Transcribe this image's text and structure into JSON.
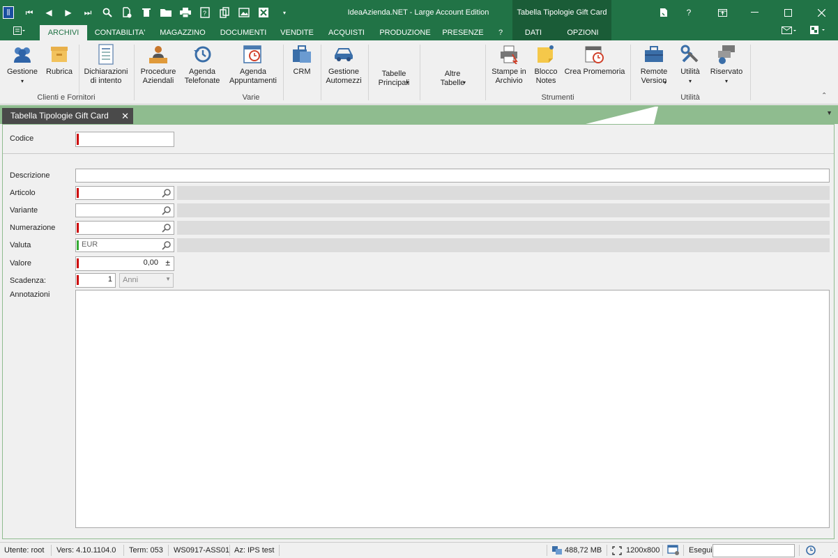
{
  "app": {
    "title": "IdeaAzienda.NET - Large Account Edition",
    "context_tab": "Tabella Tipologie Gift Card"
  },
  "ribbon_tabs": {
    "archivi": "ARCHIVI",
    "contabilita": "CONTABILITA'",
    "magazzino": "MAGAZZINO",
    "documenti": "DOCUMENTI",
    "vendite": "VENDITE",
    "acquisti": "ACQUISTI",
    "produzione": "PRODUZIONE",
    "presenze": "PRESENZE",
    "help": "?",
    "dati": "DATI",
    "opzioni": "OPZIONI"
  },
  "ribbon": {
    "gestione": "Gestione",
    "rubrica": "Rubrica",
    "dichiarazioni": "Dichiarazioni\ndi intento",
    "procedure": "Procedure\nAziendali",
    "agenda_tel": "Agenda\nTelefonate",
    "agenda_app": "Agenda\nAppuntamenti",
    "crm": "CRM",
    "automezzi": "Gestione\nAutomezzi",
    "tabelle_principali": "Tabelle\nPrincipali",
    "altre_tabelle": "Altre\nTabelle",
    "stampe": "Stampe in\nArchivio",
    "blocco": "Blocco\nNotes",
    "promemoria": "Crea Promemoria",
    "remote": "Remote\nVersion",
    "utilita": "Utilità",
    "riservato": "Riservato",
    "group_clienti": "Clienti e Fornitori",
    "group_varie": "Varie",
    "group_strumenti": "Strumenti",
    "group_utilita": "Utilità"
  },
  "document": {
    "tab_label": "Tabella Tipologie Gift Card"
  },
  "form": {
    "codice_label": "Codice",
    "descrizione_label": "Descrizione",
    "articolo_label": "Articolo",
    "variante_label": "Variante",
    "numerazione_label": "Numerazione",
    "valuta_label": "Valuta",
    "valuta_value": "EUR",
    "valore_label": "Valore",
    "valore_value": "0,00",
    "scadenza_label": "Scadenza:",
    "scadenza_value": "1",
    "scadenza_unit": "Anni",
    "annotazioni_label": "Annotazioni"
  },
  "status": {
    "utente": "Utente: root",
    "versione": "Vers: 4.10.1104.0",
    "term": "Term: 053",
    "workstation": "WS0917-ASS01",
    "azienda": "Az: IPS test",
    "memory": "488,72 MB",
    "resolution": "1200x800",
    "esegui": "Esegui"
  },
  "colors": {
    "accent": "#217346",
    "mandatory": "#cc0000",
    "tabstrip": "#8fbc8f"
  }
}
